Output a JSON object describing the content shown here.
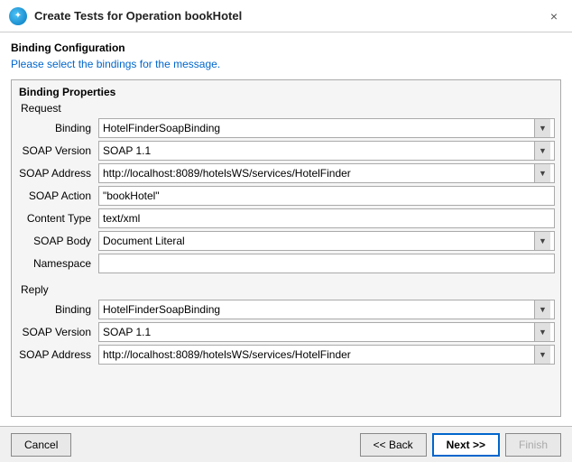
{
  "window": {
    "title": "Create Tests for Operation bookHotel",
    "close_label": "×"
  },
  "header": {
    "section_title": "Binding Configuration",
    "description_static": "Please select the bindings for the ",
    "description_link": "message",
    "description_end": "."
  },
  "binding_properties": {
    "section_label": "Binding Properties",
    "request_label": "Request",
    "reply_label": "Reply",
    "request_rows": [
      {
        "label": "Binding",
        "value": "HotelFinderSoapBinding",
        "type": "select"
      },
      {
        "label": "SOAP Version",
        "value": "SOAP 1.1",
        "type": "select"
      },
      {
        "label": "SOAP Address",
        "value": "http://localhost:8089/hotelsWS/services/HotelFinder",
        "type": "select"
      },
      {
        "label": "SOAP Action",
        "value": "\"bookHotel\"",
        "type": "input"
      },
      {
        "label": "Content Type",
        "value": "text/xml",
        "type": "input"
      },
      {
        "label": "SOAP Body",
        "value": "Document Literal",
        "type": "select"
      },
      {
        "label": "Namespace",
        "value": "",
        "type": "input"
      }
    ],
    "reply_rows": [
      {
        "label": "Binding",
        "value": "HotelFinderSoapBinding",
        "type": "select"
      },
      {
        "label": "SOAP Version",
        "value": "SOAP 1.1",
        "type": "select"
      },
      {
        "label": "SOAP Address",
        "value": "http://localhost:8089/hotelsWS/services/HotelFinder",
        "type": "select"
      }
    ]
  },
  "footer": {
    "cancel_label": "Cancel",
    "back_label": "<< Back",
    "next_label": "Next >>",
    "finish_label": "Finish"
  }
}
